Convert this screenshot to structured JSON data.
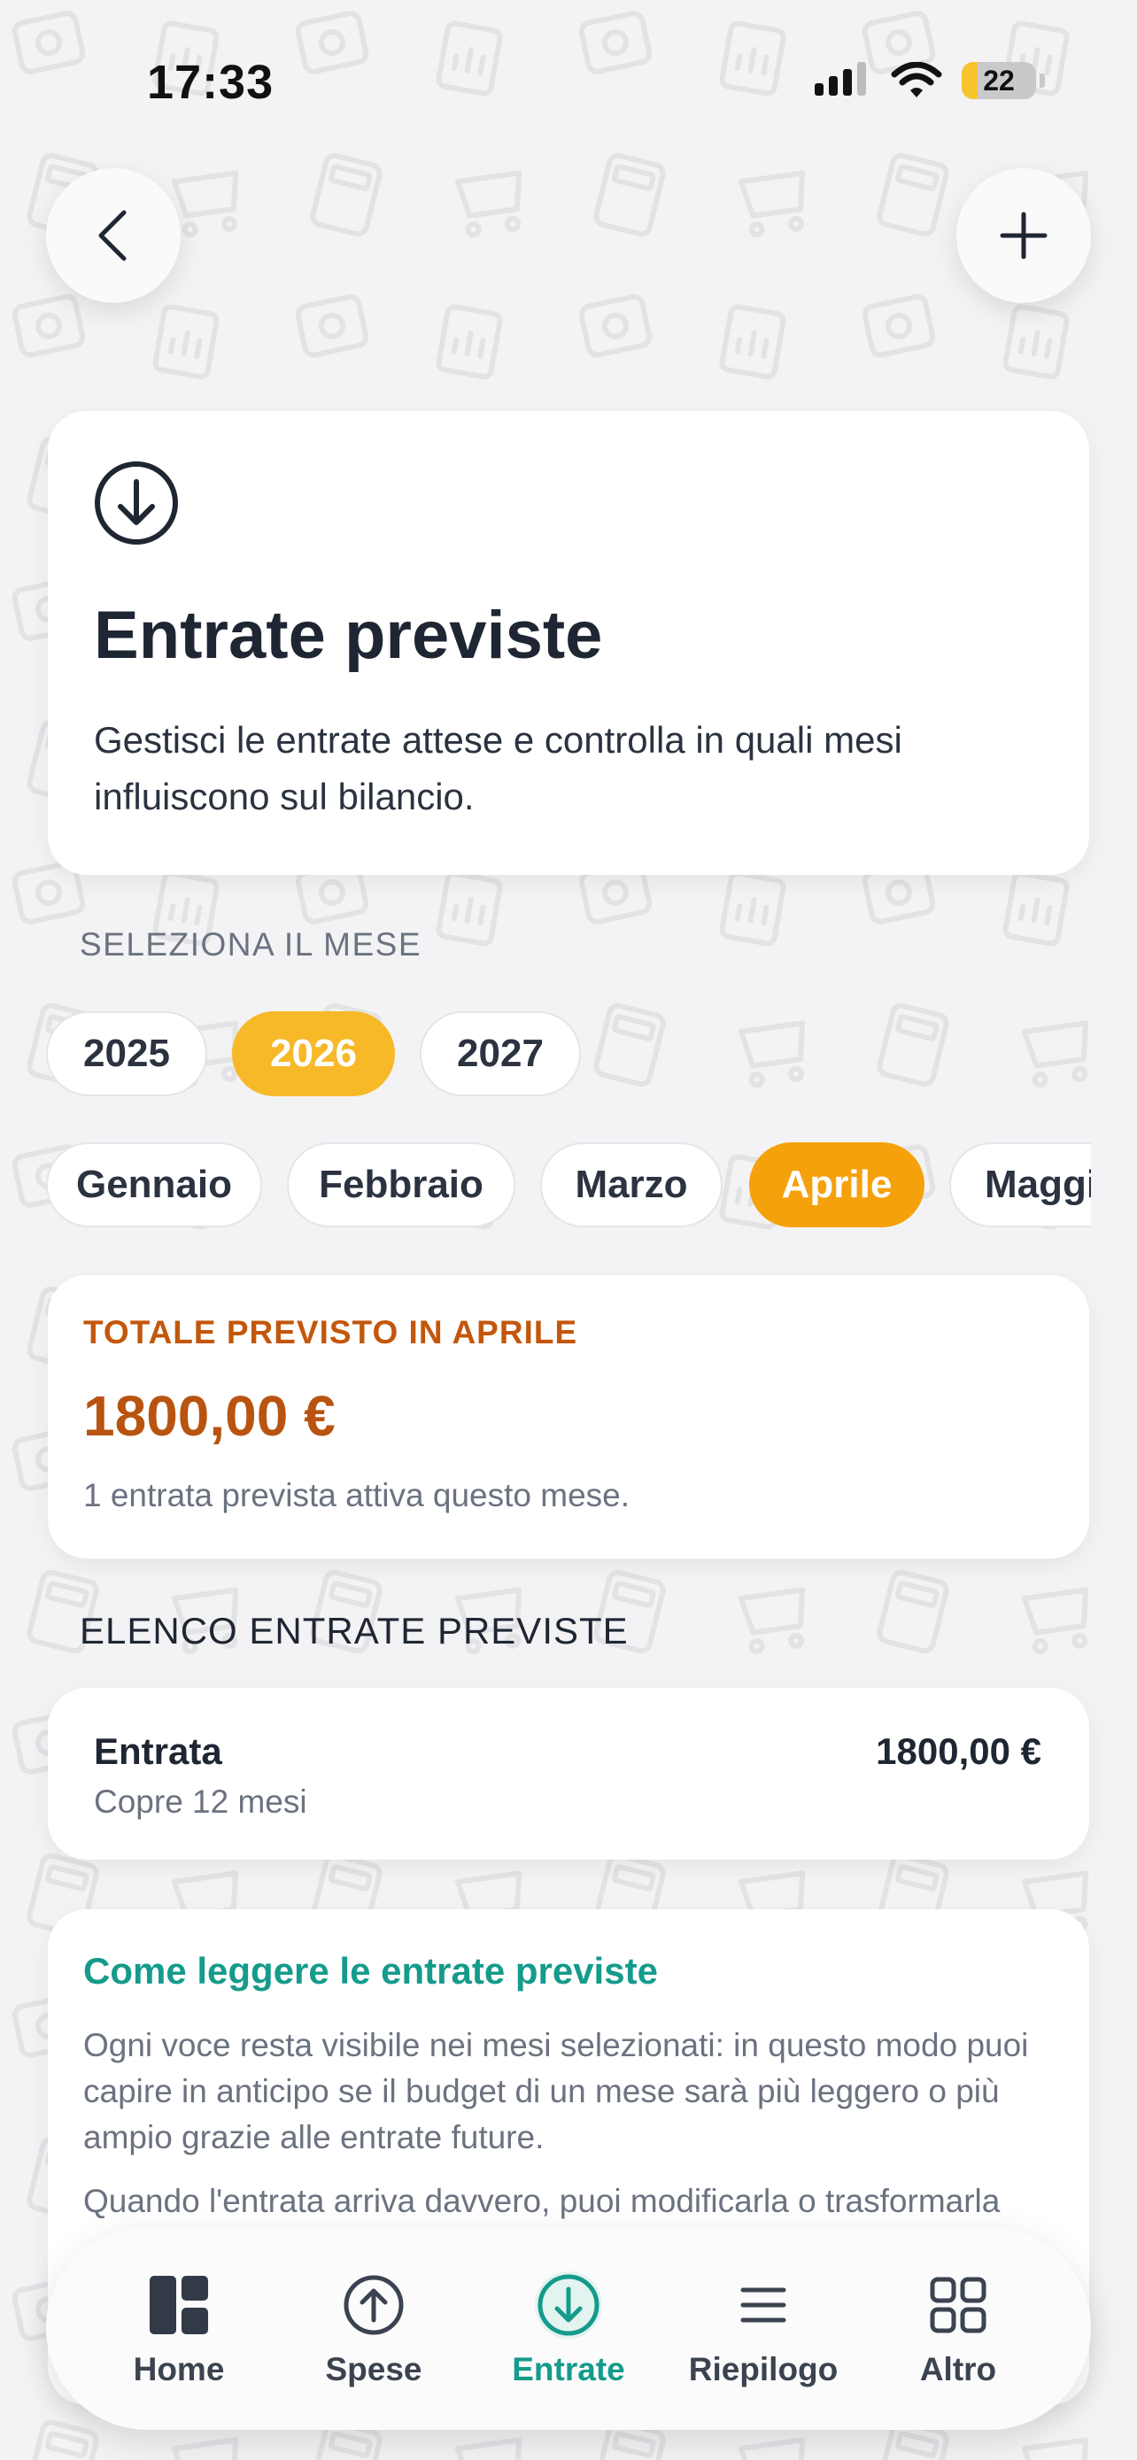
{
  "status_bar": {
    "time": "17:33",
    "battery": "22",
    "battery_level": 0.22
  },
  "hero": {
    "title": "Entrate previste",
    "description": "Gestisci le entrate attese e controlla in quali mesi influiscono sul bilancio."
  },
  "month_selector": {
    "label": "SELEZIONA IL MESE",
    "years": [
      "2025",
      "2026",
      "2027"
    ],
    "selected_year": "2026",
    "months": [
      "Gennaio",
      "Febbraio",
      "Marzo",
      "Aprile",
      "Maggi"
    ],
    "selected_month": "Aprile"
  },
  "total": {
    "label": "TOTALE PREVISTO IN APRILE",
    "amount": "1800,00 €",
    "subtitle": "1 entrata prevista attiva questo mese."
  },
  "list": {
    "label": "ELENCO ENTRATE PREVISTE",
    "items": [
      {
        "name": "Entrata",
        "coverage": "Copre 12 mesi",
        "amount": "1800,00 €"
      }
    ]
  },
  "info": {
    "title": "Come leggere le entrate previste",
    "paragraph1": "Ogni voce resta visibile nei mesi selezionati: in questo modo puoi capire in anticipo se il budget di un mese sarà più leggero o più ampio grazie alle entrate future.",
    "paragraph2": "Quando l'entrata arriva davvero, puoi modificarla o trasformarla"
  },
  "bottom_nav": [
    {
      "label": "Home",
      "icon": "dashboard-icon",
      "active": false
    },
    {
      "label": "Spese",
      "icon": "arrow-up-circle-icon",
      "active": false
    },
    {
      "label": "Entrate",
      "icon": "arrow-down-circle-icon",
      "active": true
    },
    {
      "label": "Riepilogo",
      "icon": "menu-lines-icon",
      "active": false
    },
    {
      "label": "Altro",
      "icon": "grid-icon",
      "active": false
    }
  ],
  "colors": {
    "accent_teal": "#149b8b",
    "year_active": "#f7b928",
    "month_active": "#f5a10c",
    "total_orange": "#b8540f"
  }
}
